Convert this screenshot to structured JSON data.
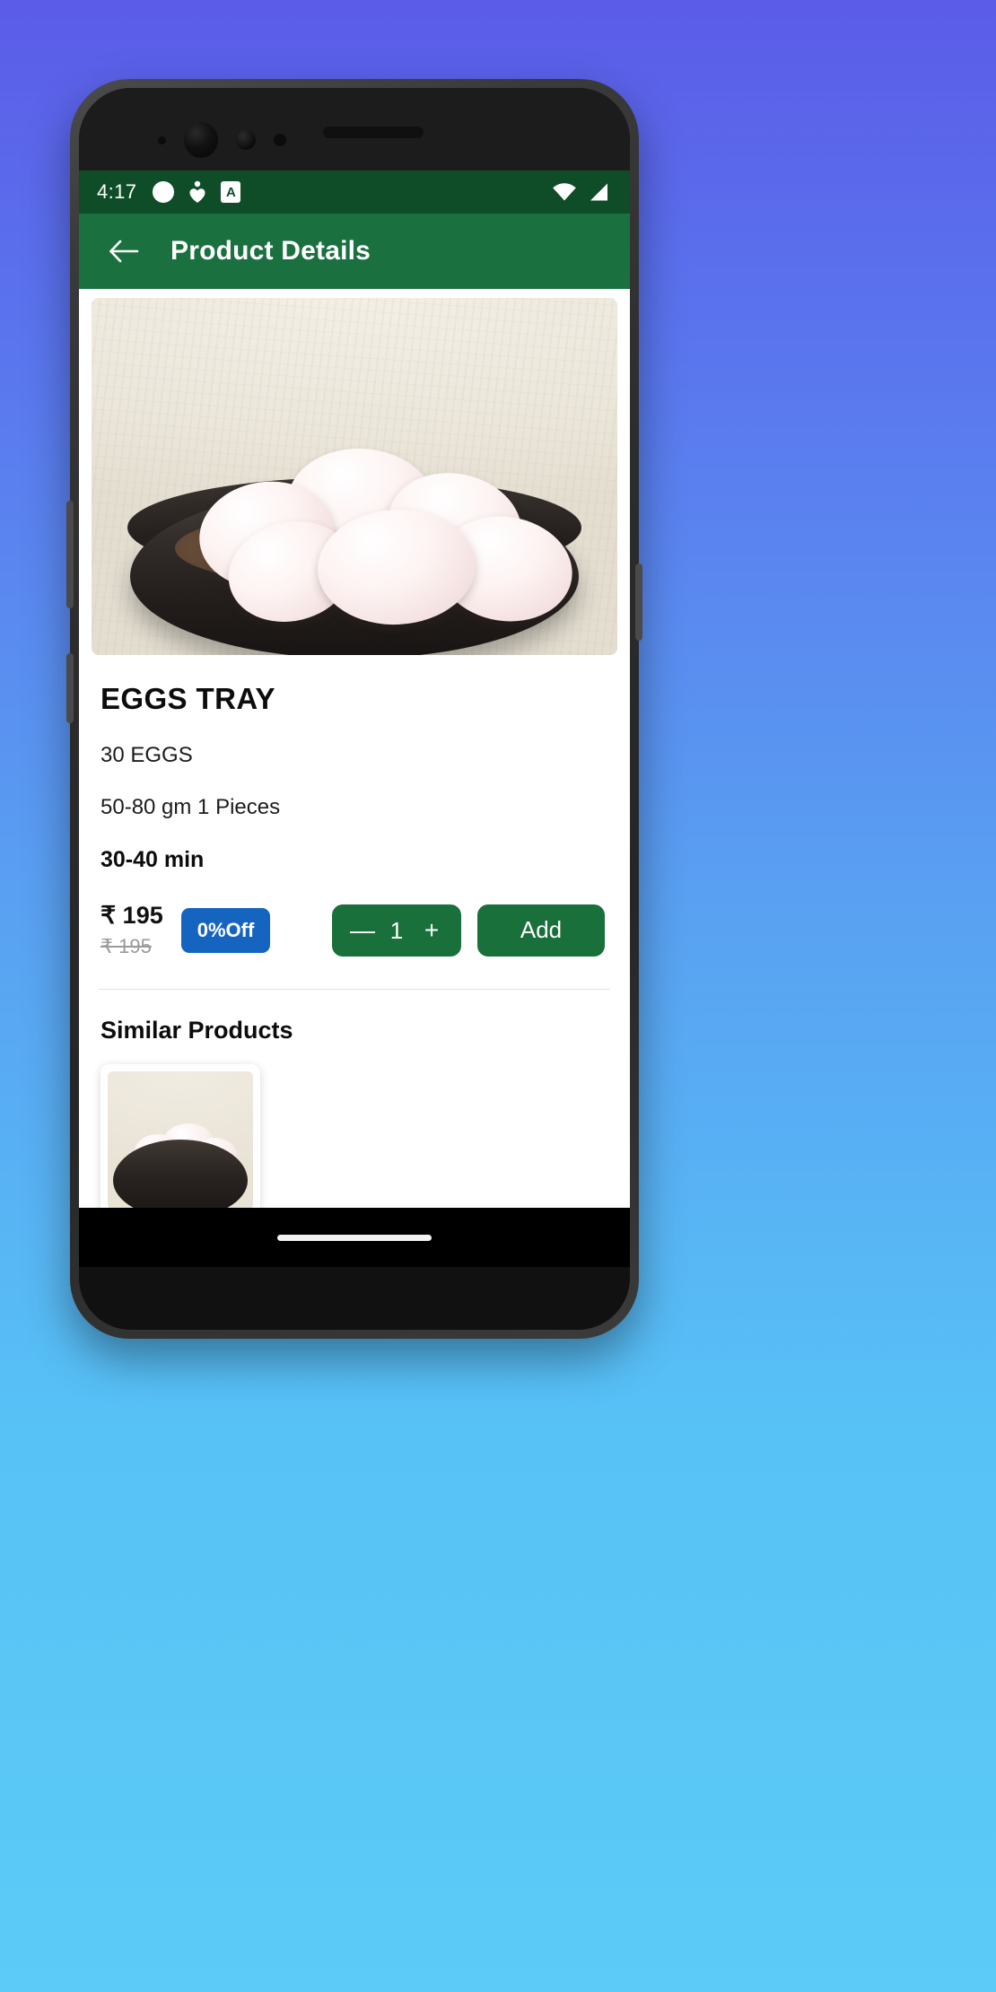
{
  "status_bar": {
    "time": "4:17",
    "left_icons": [
      "circle-indicator-icon",
      "heart-person-icon",
      "app-letter-badge-icon"
    ],
    "app_badge_letter": "A",
    "right_icons": [
      "wifi-icon",
      "cellular-signal-icon"
    ],
    "background_color": "#0e4d28"
  },
  "app_bar": {
    "back_icon": "arrow-left-icon",
    "title": "Product Details",
    "background_color": "#1b7040"
  },
  "product": {
    "hero_image_alt": "eggs-in-black-bowl-photo",
    "title": "EGGS TRAY",
    "quantity_spec": "30 EGGS",
    "weight_spec": "50-80 gm 1 Pieces",
    "prep_time": "30-40 min",
    "price_current": "₹ 195",
    "price_original": "₹ 195",
    "discount_badge": "0%Off",
    "discount_badge_color": "#1565c0"
  },
  "quantity_stepper": {
    "minus_label": "—",
    "value": "1",
    "plus_label": "+",
    "background_color": "#19703a"
  },
  "add_button": {
    "label": "Add",
    "background_color": "#19703a"
  },
  "similar_products": {
    "heading": "Similar Products",
    "items": [
      {
        "image_alt": "eggs-in-black-bowl-thumbnail"
      }
    ]
  },
  "nav_bar": {
    "home_indicator": "home-gesture-bar"
  }
}
